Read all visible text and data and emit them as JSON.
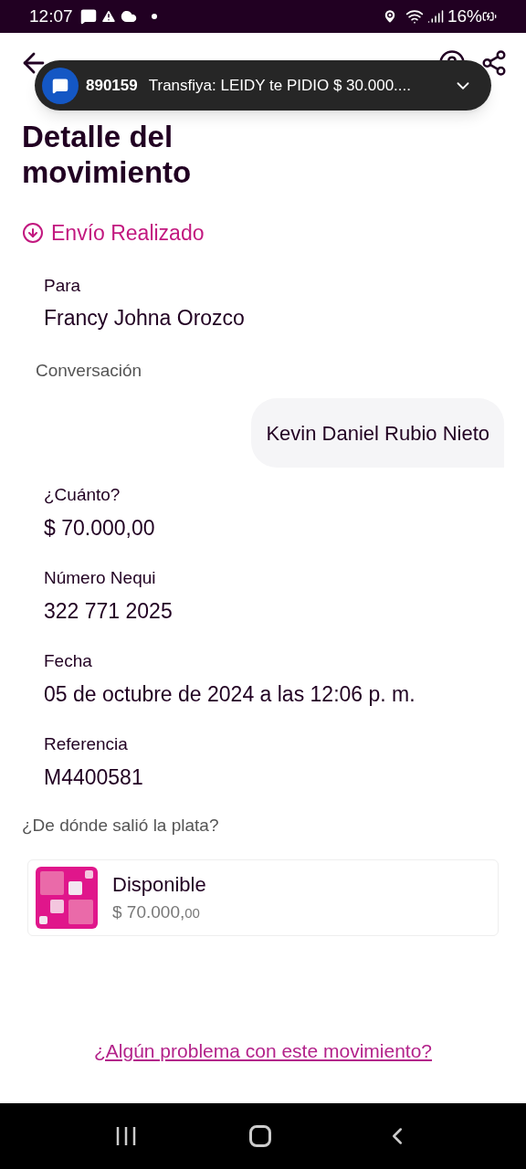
{
  "status_bar": {
    "time": "12:07",
    "battery": "16%"
  },
  "notification": {
    "sender": "890159",
    "text": "Transfiya: LEIDY te PIDIO $ 30.000...."
  },
  "title": "Detalle del movimiento",
  "status": "Envío Realizado",
  "recipient": {
    "label": "Para",
    "value": "Francy Johna Orozco"
  },
  "conversation": {
    "label": "Conversación",
    "message": "Kevin Daniel Rubio Nieto"
  },
  "fields": [
    {
      "label": "¿Cuánto?",
      "value": "$ 70.000,00"
    },
    {
      "label": "Número Nequi",
      "value": "322 771 2025"
    },
    {
      "label": "Fecha",
      "value": "05 de octubre de 2024 a las 12:06 p. m."
    },
    {
      "label": "Referencia",
      "value": "M4400581"
    }
  ],
  "source": {
    "question": "¿De dónde salió la plata?",
    "name": "Disponible",
    "amount": "$ 70.000,",
    "cents": "00"
  },
  "help_link": "¿Algún problema con este movimiento?"
}
